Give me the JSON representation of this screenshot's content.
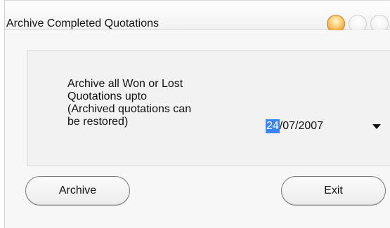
{
  "window": {
    "title": "Archive Completed Quotations"
  },
  "dialog": {
    "message_lines": [
      "Archive all Won or Lost",
      "Quotations upto",
      "(Archived quotations can",
      "be restored)"
    ],
    "date_selected_part": "24",
    "date_rest": "/07/2007"
  },
  "buttons": {
    "archive_label": "Archive",
    "exit_label": "Exit"
  },
  "colors": {
    "accent": "#3a84f3",
    "close_button": "#f4a33e"
  },
  "icons": {
    "close": "close-icon",
    "minimize": "minimize-icon",
    "maximize": "maximize-icon",
    "dropdown": "chevron-down-icon"
  }
}
